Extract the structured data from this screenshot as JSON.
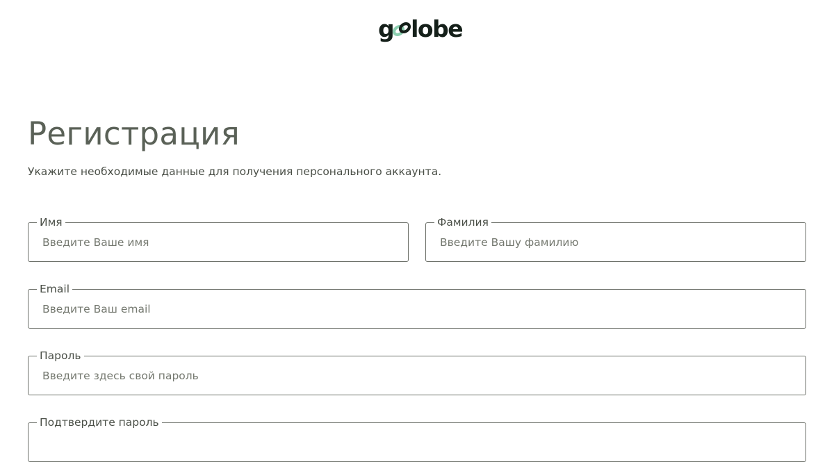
{
  "logo": {
    "prefix": "g",
    "suffix": "lobe",
    "mark_color": "#8ccfb0",
    "text_color": "#15201a"
  },
  "page": {
    "title": "Регистрация",
    "subtitle": "Укажите необходимые данные для получения персонального аккаунта."
  },
  "form": {
    "first_name": {
      "label": "Имя",
      "placeholder": "Введите Ваше имя",
      "value": ""
    },
    "last_name": {
      "label": "Фамилия",
      "placeholder": "Введите Вашу фамилию",
      "value": ""
    },
    "email": {
      "label": "Email",
      "placeholder": "Введите Ваш email",
      "value": ""
    },
    "password": {
      "label": "Пароль",
      "placeholder": "Введите здесь свой пароль",
      "value": ""
    },
    "confirm_password": {
      "label": "Подтвердите пароль",
      "placeholder": "",
      "value": ""
    }
  },
  "colors": {
    "title": "#5a6157",
    "border": "#6b6f68",
    "background": "#ffffff"
  }
}
